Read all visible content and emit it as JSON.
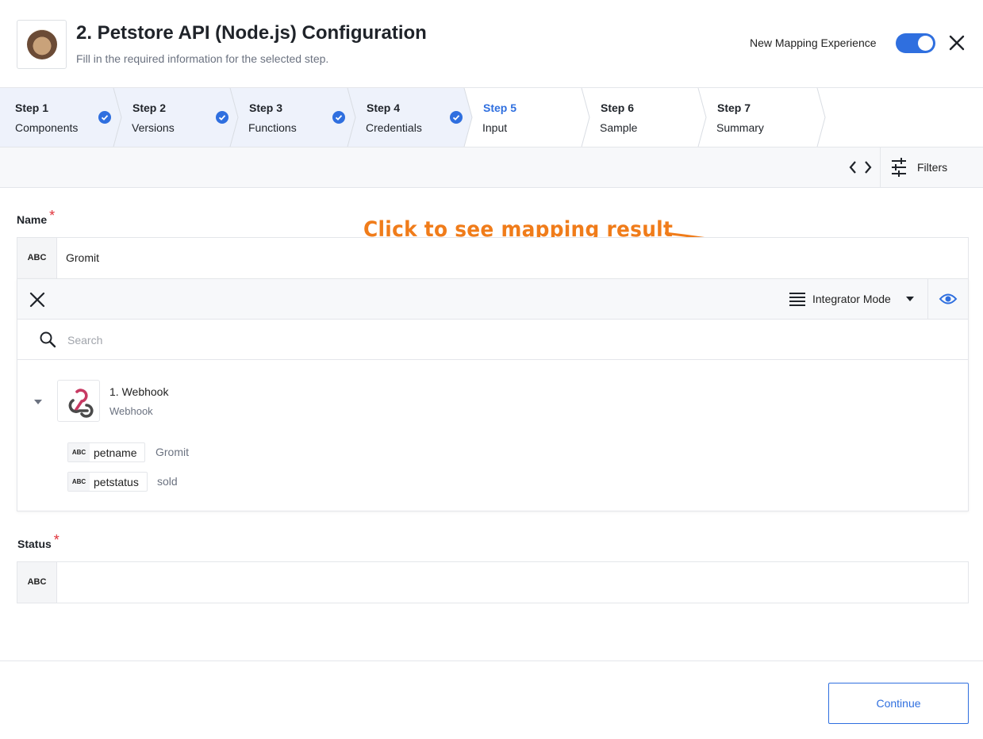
{
  "header": {
    "title": "2. Petstore API (Node.js) Configuration",
    "subtitle": "Fill in the required information for the selected step.",
    "new_mapping_label": "New Mapping Experience",
    "new_mapping_enabled": true
  },
  "steps": [
    {
      "num": "Step 1",
      "label": "Components",
      "complete": true
    },
    {
      "num": "Step 2",
      "label": "Versions",
      "complete": true
    },
    {
      "num": "Step 3",
      "label": "Functions",
      "complete": true
    },
    {
      "num": "Step 4",
      "label": "Credentials",
      "complete": true
    },
    {
      "num": "Step 5",
      "label": "Input",
      "active": true
    },
    {
      "num": "Step 6",
      "label": "Sample"
    },
    {
      "num": "Step 7",
      "label": "Summary"
    }
  ],
  "toolbar": {
    "filters_label": "Filters"
  },
  "name_field": {
    "label": "Name",
    "required_mark": "*",
    "type_tag": "ABC",
    "value": "Gromit"
  },
  "annotation": {
    "text": "Click to see mapping result"
  },
  "mapping_panel": {
    "mode_label": "Integrator Mode",
    "search_placeholder": "Search",
    "source": {
      "title": "1. Webhook",
      "subtitle": "Webhook",
      "fields": [
        {
          "tag": "ABC",
          "name": "petname",
          "value": "Gromit"
        },
        {
          "tag": "ABC",
          "name": "petstatus",
          "value": "sold"
        }
      ]
    }
  },
  "status_field": {
    "label": "Status",
    "required_mark": "*",
    "type_tag": "ABC",
    "value": ""
  },
  "footer": {
    "continue_label": "Continue"
  },
  "colors": {
    "accent": "#2f6fdf",
    "annotation": "#f07c1a",
    "required": "#e0323a"
  }
}
